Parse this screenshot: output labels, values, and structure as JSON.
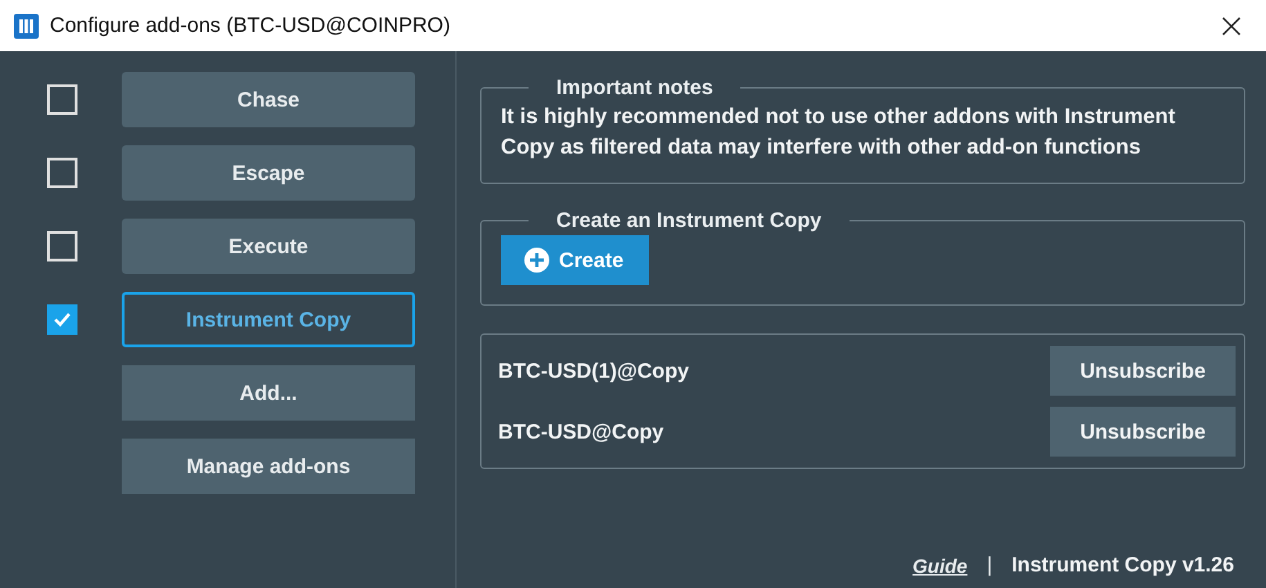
{
  "window": {
    "title": "Configure add-ons (BTC-USD@COINPRO)"
  },
  "addons": [
    {
      "label": "Chase",
      "checked": false,
      "selected": false
    },
    {
      "label": "Escape",
      "checked": false,
      "selected": false
    },
    {
      "label": "Execute",
      "checked": false,
      "selected": false
    },
    {
      "label": "Instrument Copy",
      "checked": true,
      "selected": true
    }
  ],
  "actions": [
    "Add...",
    "Manage add-ons"
  ],
  "notes": {
    "title": "Important notes",
    "text": "It is highly recommended not to use other addons with Instrument Copy as filtered data may interfere with other add-on functions"
  },
  "create": {
    "title": "Create an Instrument Copy",
    "button": "Create"
  },
  "copies": [
    {
      "name": "BTC-USD(1)@Copy",
      "button": "Unsubscribe"
    },
    {
      "name": "BTC-USD@Copy",
      "button": "Unsubscribe"
    }
  ],
  "footer": {
    "link": "Guide",
    "separator": "|",
    "version": "Instrument Copy v1.26"
  }
}
